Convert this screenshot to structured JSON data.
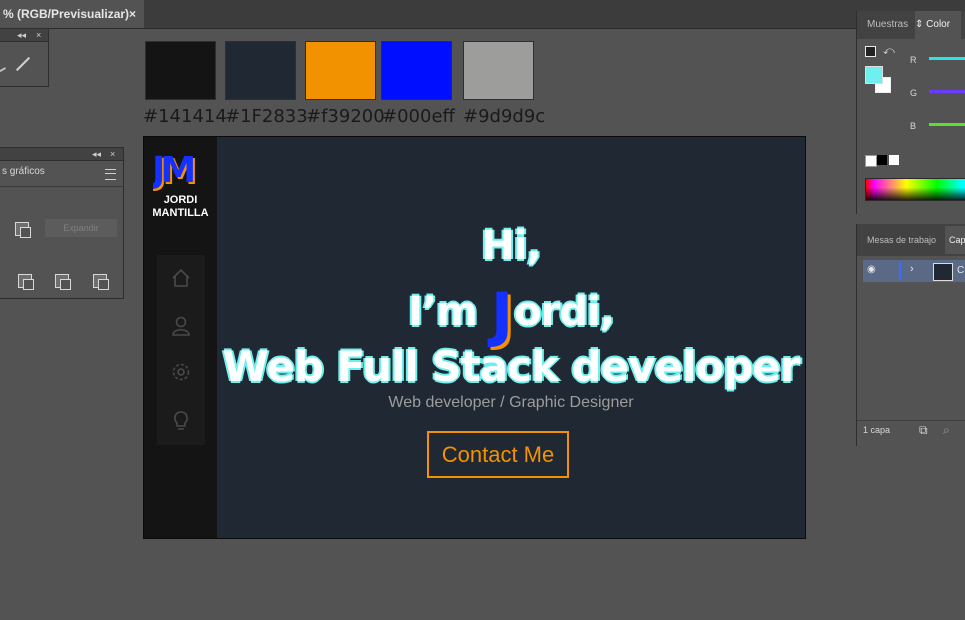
{
  "document_tab": {
    "title": "% (RGB/Previsualizar)",
    "close": "×"
  },
  "tools_panel": {
    "collapse": "◂◂",
    "close": "×"
  },
  "pathfinder_panel": {
    "collapse": "◂◂",
    "close": "×",
    "title": "s gráficos",
    "expand_button": "Expandir"
  },
  "swatches": [
    {
      "hex": "#141414",
      "label": "#141414"
    },
    {
      "hex": "#1F2833",
      "label": "#1F2833"
    },
    {
      "hex": "#f39200",
      "label": "#f39200"
    },
    {
      "hex": "#000eff",
      "label": "#000eff"
    },
    {
      "hex": "#9d9d9c",
      "label": "#9d9d9c"
    }
  ],
  "artboard": {
    "logo_text": "JM",
    "brand_name_line1": "JORDI",
    "brand_name_line2": "MANTILLA",
    "nav_icons": [
      "home-icon",
      "user-icon",
      "gear-icon",
      "lightbulb-icon"
    ],
    "hero": {
      "line1": "Hi,",
      "line2_prefix": "I’m",
      "line2_letter": "J",
      "line2_suffix": "ordi,",
      "line3": "Web Full Stack developer",
      "subtitle": "Web developer / Graphic Designer",
      "cta": "Contact Me"
    },
    "colors": {
      "background": "#1F2833",
      "sidebar": "#141414",
      "accent": "#f39200",
      "blue": "#000eff",
      "grey": "#9d9d9c",
      "outline": "#6ef0ee"
    }
  },
  "color_panel": {
    "tabs": [
      "Muestras",
      "Color"
    ],
    "active_tab": "Color",
    "channels": [
      {
        "label": "R",
        "color": "#29e6e6"
      },
      {
        "label": "G",
        "color": "#6a3cff"
      },
      {
        "label": "B",
        "color": "#5ce02e"
      }
    ],
    "fill_color": "#6ef0ee"
  },
  "layers_panel": {
    "tabs": [
      "Mesas de trabajo",
      "Cap"
    ],
    "layer_name": "C",
    "footer_count": "1 capa"
  }
}
